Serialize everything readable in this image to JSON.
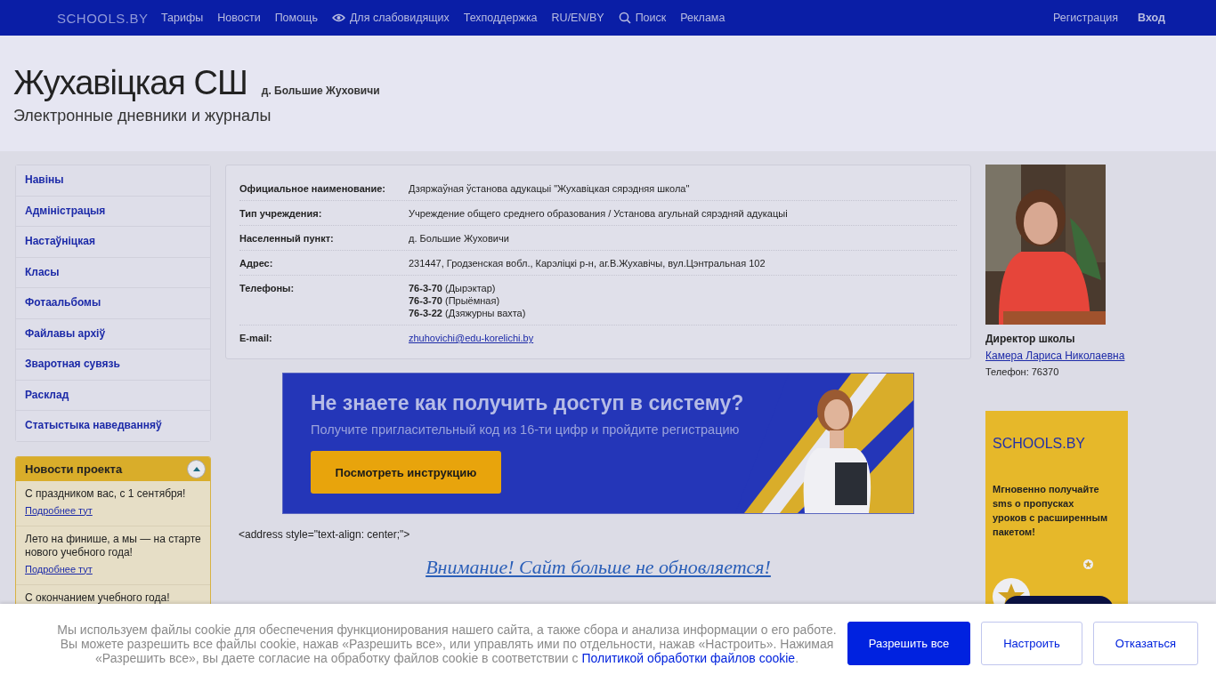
{
  "nav": {
    "logo": "SCHOOLS.BY",
    "links": [
      {
        "label": "Тарифы",
        "kind": "plain"
      },
      {
        "label": "Новости",
        "kind": "plain"
      },
      {
        "label": "Помощь",
        "kind": "plain"
      },
      {
        "label": "Для слабовидящих",
        "kind": "accessibility"
      },
      {
        "label": "Техподдержка",
        "kind": "plain"
      },
      {
        "label": "RU/EN/BY",
        "kind": "plain"
      },
      {
        "label": "Поиск",
        "kind": "search"
      },
      {
        "label": "Реклама",
        "kind": "plain"
      }
    ],
    "account": [
      {
        "label": "Регистрация",
        "kind": "plain"
      },
      {
        "label": "Вход",
        "kind": "strong"
      }
    ]
  },
  "header": {
    "title": "Жухавіцкая СШ",
    "place": "д. Большие Жуховичи",
    "subtitle": "Электронные дневники и журналы"
  },
  "sidebar": {
    "items": [
      "Навіны",
      "Адміністрацыя",
      "Настаўніцкая",
      "Класы",
      "Фотаальбомы",
      "Файлавы архіў",
      "Зваротная сувязь",
      "Расклад",
      "Статыстыка наведванняў"
    ],
    "news": {
      "title": "Новости проекта",
      "expanded": true,
      "items": [
        {
          "text": "С праздником вас, с 1 сентября!",
          "link": "Подробнее тут"
        },
        {
          "text": "Лето на финише, а мы — на старте нового учебного года!",
          "link": "Подробнее тут"
        },
        {
          "text": "С окончанием учебного года!"
        }
      ]
    }
  },
  "info": {
    "rows": [
      {
        "label": "Официальное наименование:",
        "kind": "text",
        "values": [
          "Дзяржаўная ўстанова адукацыі \"Жухавіцкая сярэдняя школа\""
        ]
      },
      {
        "label": "Тип учреждения:",
        "kind": "text",
        "values": [
          "Учреждение общего среднего образования / Установа агульнай сярэдняй адукацыі"
        ]
      },
      {
        "label": "Населенный пункт:",
        "kind": "text",
        "values": [
          "д. Большие Жуховичи"
        ]
      },
      {
        "label": "Адрес:",
        "kind": "text",
        "values": [
          "231447, Гродзенская вобл., Карэліцкі р-н, аг.В.Жухавічы, вул.Цэнтральная 102"
        ]
      },
      {
        "label": "Телефоны:",
        "kind": "text",
        "values": [
          "**76-3-70** (Дырэктар)",
          "**76-3-70** (Прыёмная)",
          "**76-3-22** (Дзяжурны вахта)"
        ]
      },
      {
        "label": "E-mail:",
        "kind": "link",
        "values": [
          "zhuhovichi@edu-korelichi.by"
        ]
      }
    ]
  },
  "promo": {
    "title": "Не знаете как получить доступ в систему?",
    "subtitle": "Получите пригласительный код из 16-ти цифр и пройдите регистрацию",
    "button": "Посмотреть инструкцию"
  },
  "content": {
    "code_text": "<address style=\"text-align: center;\">",
    "notice": "Внимание! Сайт больше не обновляется!"
  },
  "director": {
    "role": "Директор школы",
    "name": "Камера Лариса Николаевна",
    "phone": "Телефон: 76370"
  },
  "sms_ad": {
    "logo": "SCHOOLS.BY",
    "text": "Мгновенно получайте sms о пропусках уроков с расширенным пакетом!"
  },
  "cookie": {
    "text": "Мы используем файлы cookie для обеспечения функционирования нашего сайта, а также сбора и анализа информации о его работе. Вы можете разрешить все файлы cookie, нажав «Разрешить все», или управлять ими по отдельности, нажав «Настроить». Нажимая «Разрешить все», вы даете согласие на обработку файлов cookie в соответствии с",
    "link": "Политикой обработки файлов cookie",
    "end": ".",
    "buttons": [
      {
        "label": "Разрешить все",
        "kind": "primary"
      },
      {
        "label": "Настроить",
        "kind": "outline"
      },
      {
        "label": "Отказаться",
        "kind": "outline"
      }
    ]
  }
}
